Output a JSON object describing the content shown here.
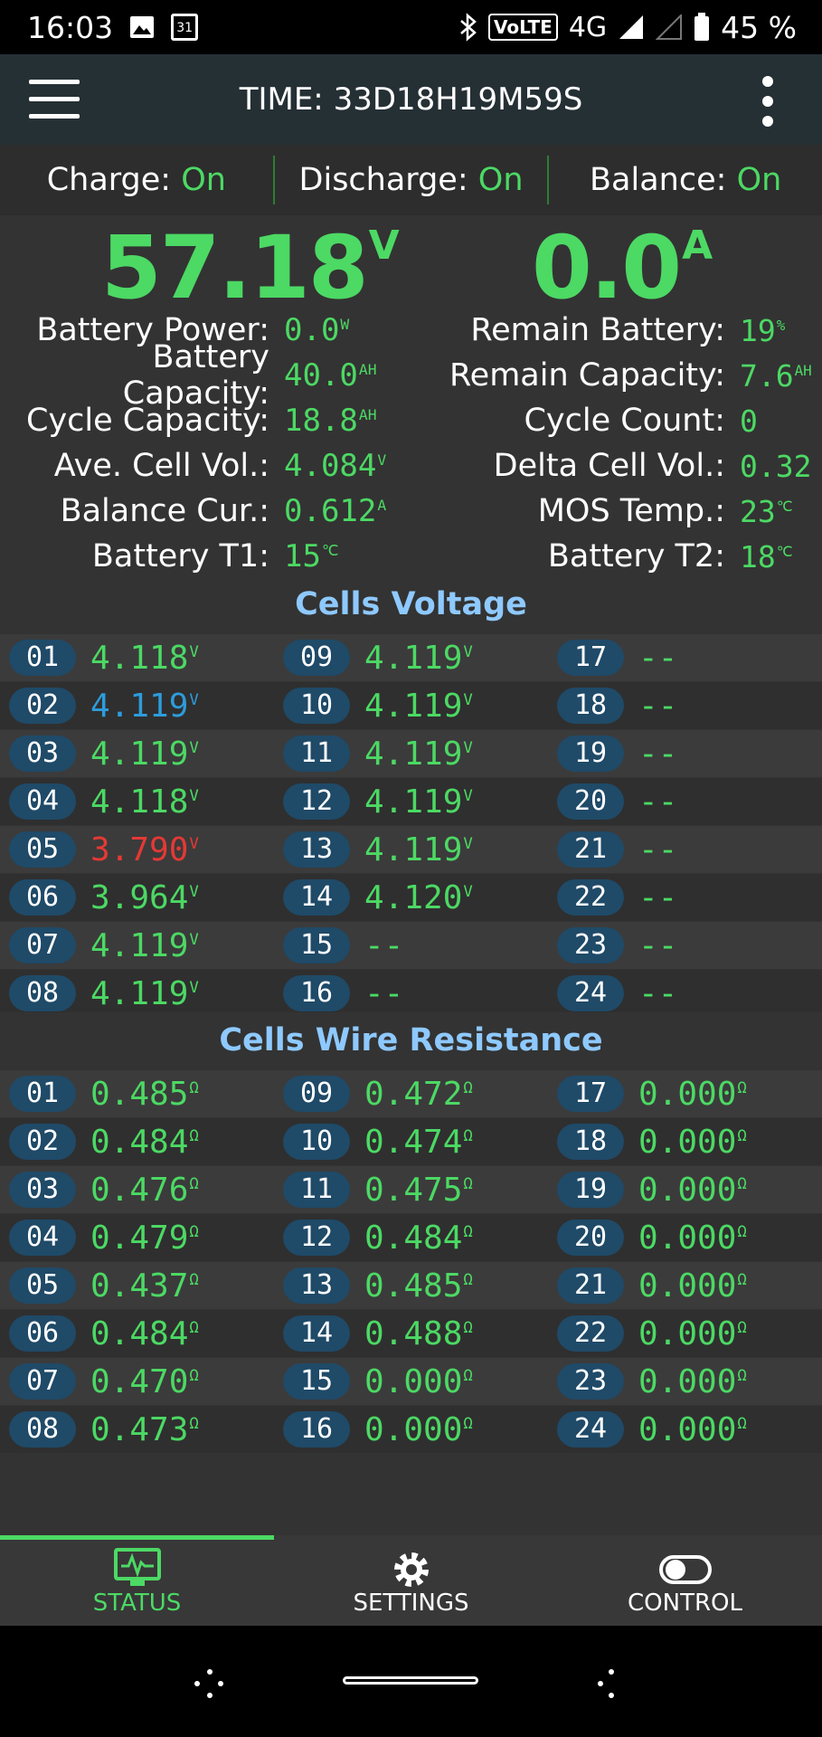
{
  "status_bar": {
    "time": "16:03",
    "calendar_day": "31",
    "volte": "VoLTE",
    "network": "4G",
    "battery_pct": "45 %"
  },
  "header": {
    "title": "TIME: 33D18H19M59S"
  },
  "switches": {
    "charge_label": "Charge:",
    "charge_value": "On",
    "discharge_label": "Discharge:",
    "discharge_value": "On",
    "balance_label": "Balance:",
    "balance_value": "On"
  },
  "main": {
    "voltage": "57.18",
    "voltage_unit": "V",
    "current": "0.0",
    "current_unit": "A",
    "left": [
      {
        "label": "Battery Power:",
        "value": "0.0",
        "unit": "W"
      },
      {
        "label": "Battery Capacity:",
        "value": "40.0",
        "unit": "AH"
      },
      {
        "label": "Cycle Capacity:",
        "value": "18.8",
        "unit": "AH"
      },
      {
        "label": "Ave. Cell Vol.:",
        "value": "4.084",
        "unit": "V"
      },
      {
        "label": "Balance Cur.:",
        "value": "0.612",
        "unit": "A"
      },
      {
        "label": "Battery T1:",
        "value": "15",
        "unit": "℃"
      }
    ],
    "right": [
      {
        "label": "Remain Battery:",
        "value": "19",
        "unit": "%"
      },
      {
        "label": "Remain Capacity:",
        "value": "7.6",
        "unit": "AH"
      },
      {
        "label": "Cycle Count:",
        "value": "0",
        "unit": ""
      },
      {
        "label": "Delta Cell Vol.:",
        "value": "0.32",
        "unit": ""
      },
      {
        "label": "MOS Temp.:",
        "value": "23",
        "unit": "℃"
      },
      {
        "label": "Battery T2:",
        "value": "18",
        "unit": "℃"
      }
    ]
  },
  "cells_voltage": {
    "title": "Cells Voltage",
    "cells": [
      {
        "id": "01",
        "value": "4.118",
        "unit": "V",
        "color": "#4cd964"
      },
      {
        "id": "02",
        "value": "4.119",
        "unit": "V",
        "color": "#2d9cdb"
      },
      {
        "id": "03",
        "value": "4.119",
        "unit": "V",
        "color": "#4cd964"
      },
      {
        "id": "04",
        "value": "4.118",
        "unit": "V",
        "color": "#4cd964"
      },
      {
        "id": "05",
        "value": "3.790",
        "unit": "V",
        "color": "#e53935"
      },
      {
        "id": "06",
        "value": "3.964",
        "unit": "V",
        "color": "#4cd964"
      },
      {
        "id": "07",
        "value": "4.119",
        "unit": "V",
        "color": "#4cd964"
      },
      {
        "id": "08",
        "value": "4.119",
        "unit": "V",
        "color": "#4cd964"
      },
      {
        "id": "09",
        "value": "4.119",
        "unit": "V",
        "color": "#4cd964"
      },
      {
        "id": "10",
        "value": "4.119",
        "unit": "V",
        "color": "#4cd964"
      },
      {
        "id": "11",
        "value": "4.119",
        "unit": "V",
        "color": "#4cd964"
      },
      {
        "id": "12",
        "value": "4.119",
        "unit": "V",
        "color": "#4cd964"
      },
      {
        "id": "13",
        "value": "4.119",
        "unit": "V",
        "color": "#4cd964"
      },
      {
        "id": "14",
        "value": "4.120",
        "unit": "V",
        "color": "#4cd964"
      },
      {
        "id": "15",
        "value": "--",
        "unit": "",
        "color": "#4cd964"
      },
      {
        "id": "16",
        "value": "--",
        "unit": "",
        "color": "#4cd964"
      },
      {
        "id": "17",
        "value": "--",
        "unit": "",
        "color": "#4cd964"
      },
      {
        "id": "18",
        "value": "--",
        "unit": "",
        "color": "#4cd964"
      },
      {
        "id": "19",
        "value": "--",
        "unit": "",
        "color": "#4cd964"
      },
      {
        "id": "20",
        "value": "--",
        "unit": "",
        "color": "#4cd964"
      },
      {
        "id": "21",
        "value": "--",
        "unit": "",
        "color": "#4cd964"
      },
      {
        "id": "22",
        "value": "--",
        "unit": "",
        "color": "#4cd964"
      },
      {
        "id": "23",
        "value": "--",
        "unit": "",
        "color": "#4cd964"
      },
      {
        "id": "24",
        "value": "--",
        "unit": "",
        "color": "#4cd964"
      }
    ]
  },
  "cells_resistance": {
    "title": "Cells Wire Resistance",
    "cells": [
      {
        "id": "01",
        "value": "0.485",
        "unit": "Ω"
      },
      {
        "id": "02",
        "value": "0.484",
        "unit": "Ω"
      },
      {
        "id": "03",
        "value": "0.476",
        "unit": "Ω"
      },
      {
        "id": "04",
        "value": "0.479",
        "unit": "Ω"
      },
      {
        "id": "05",
        "value": "0.437",
        "unit": "Ω"
      },
      {
        "id": "06",
        "value": "0.484",
        "unit": "Ω"
      },
      {
        "id": "07",
        "value": "0.470",
        "unit": "Ω"
      },
      {
        "id": "08",
        "value": "0.473",
        "unit": "Ω"
      },
      {
        "id": "09",
        "value": "0.472",
        "unit": "Ω"
      },
      {
        "id": "10",
        "value": "0.474",
        "unit": "Ω"
      },
      {
        "id": "11",
        "value": "0.475",
        "unit": "Ω"
      },
      {
        "id": "12",
        "value": "0.484",
        "unit": "Ω"
      },
      {
        "id": "13",
        "value": "0.485",
        "unit": "Ω"
      },
      {
        "id": "14",
        "value": "0.488",
        "unit": "Ω"
      },
      {
        "id": "15",
        "value": "0.000",
        "unit": "Ω"
      },
      {
        "id": "16",
        "value": "0.000",
        "unit": "Ω"
      },
      {
        "id": "17",
        "value": "0.000",
        "unit": "Ω"
      },
      {
        "id": "18",
        "value": "0.000",
        "unit": "Ω"
      },
      {
        "id": "19",
        "value": "0.000",
        "unit": "Ω"
      },
      {
        "id": "20",
        "value": "0.000",
        "unit": "Ω"
      },
      {
        "id": "21",
        "value": "0.000",
        "unit": "Ω"
      },
      {
        "id": "22",
        "value": "0.000",
        "unit": "Ω"
      },
      {
        "id": "23",
        "value": "0.000",
        "unit": "Ω"
      },
      {
        "id": "24",
        "value": "0.000",
        "unit": "Ω"
      }
    ]
  },
  "bottom_nav": [
    {
      "label": "STATUS",
      "icon": "monitor-pulse-icon",
      "active": true
    },
    {
      "label": "SETTINGS",
      "icon": "gear-icon",
      "active": false
    },
    {
      "label": "CONTROL",
      "icon": "toggle-icon",
      "active": false
    }
  ],
  "colors": {
    "accent": "#4cd964",
    "appbar": "#253035",
    "badge": "#1f4a68",
    "section_title": "#8ec9ff"
  }
}
